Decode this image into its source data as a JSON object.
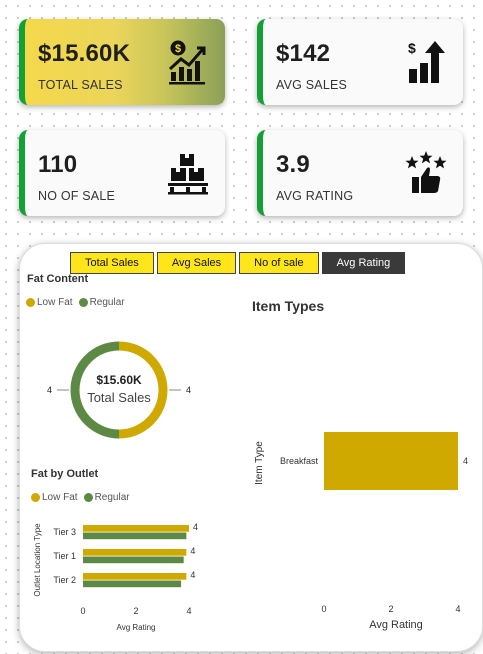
{
  "colors": {
    "accent_green": "#13a135",
    "low_fat": "#cfa800",
    "regular": "#5c8a45",
    "tab_active": "#3a3a3a",
    "tab_bg": "#ffe61a"
  },
  "cards": [
    {
      "value": "$15.60K",
      "label": "TOTAL SALES",
      "icon": "money-chart-icon"
    },
    {
      "value": "$142",
      "label": "AVG SALES",
      "icon": "dollar-bars-arrow-icon"
    },
    {
      "value": "110",
      "label": "NO OF SALE",
      "icon": "boxes-pallet-icon"
    },
    {
      "value": "3.9",
      "label": "AVG RATING",
      "icon": "stars-thumbs-up-icon"
    }
  ],
  "tabs": [
    {
      "label": "Total Sales",
      "active": false
    },
    {
      "label": "Avg Sales",
      "active": false
    },
    {
      "label": "No of sale",
      "active": false
    },
    {
      "label": "Avg Rating",
      "active": true
    }
  ],
  "fat_content": {
    "title": "Fat Content",
    "legend": [
      "Low Fat",
      "Regular"
    ]
  },
  "fat_by_outlet": {
    "title": "Fat by Outlet",
    "legend": [
      "Low Fat",
      "Regular"
    ]
  },
  "item_types": {
    "title": "Item Types"
  },
  "chart_data": [
    {
      "type": "pie",
      "title": "Fat Content",
      "categories": [
        "Low Fat",
        "Regular"
      ],
      "values": [
        4,
        4
      ],
      "data_labels": [
        "4",
        "4"
      ],
      "center_value": "$15.60K",
      "center_label": "Total Sales",
      "donut": true
    },
    {
      "type": "bar",
      "orientation": "horizontal",
      "title": "Fat by Outlet",
      "categories": [
        "Tier 3",
        "Tier 1",
        "Tier 2"
      ],
      "series": [
        {
          "name": "Low Fat",
          "values": [
            4.0,
            3.9,
            3.9
          ]
        },
        {
          "name": "Regular",
          "values": [
            3.9,
            3.8,
            3.7
          ]
        }
      ],
      "data_labels": [
        "4",
        "4",
        "4"
      ],
      "xlabel": "Avg Rating",
      "ylabel": "Outlet Location Type",
      "xlim": [
        0,
        4
      ],
      "xticks": [
        0,
        2,
        4
      ],
      "grid": false
    },
    {
      "type": "bar",
      "orientation": "horizontal",
      "title": "Item Types",
      "categories": [
        "Breakfast"
      ],
      "values": [
        4
      ],
      "data_labels": [
        "4"
      ],
      "xlabel": "Avg Rating",
      "ylabel": "Item Type",
      "xlim": [
        0,
        4
      ],
      "xticks": [
        0,
        2,
        4
      ],
      "grid": false
    }
  ]
}
